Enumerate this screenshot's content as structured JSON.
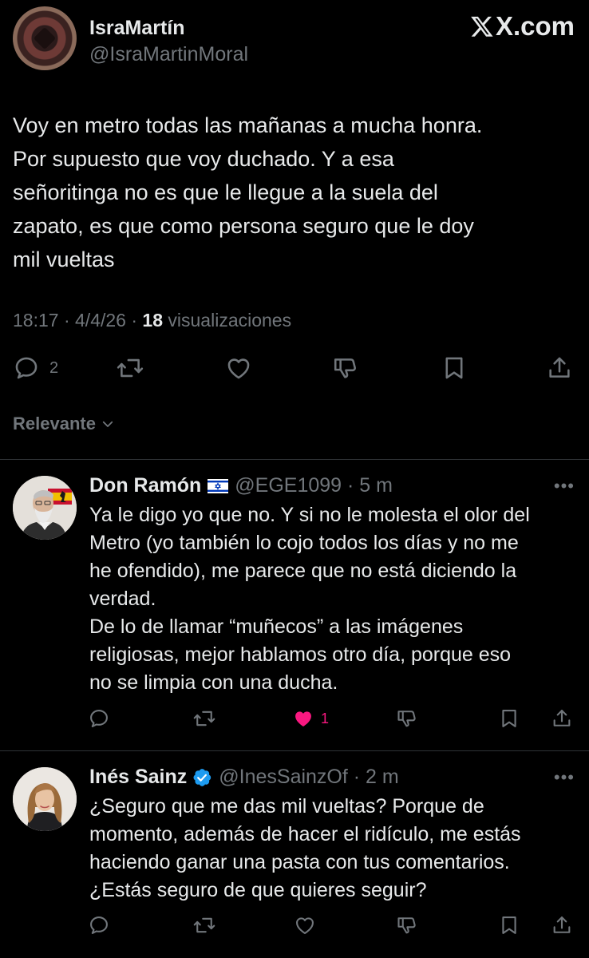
{
  "brand": "X.com",
  "main_tweet": {
    "author_name": "IsraMartín",
    "author_handle": "@IsraMartinMoral",
    "text_lines": [
      "Voy en metro todas las mañanas a mucha honra.",
      "Por supuesto que voy duchado. Y a esa",
      "señoritinga no es que le llegue a la suela del",
      "zapato, es que como persona seguro que le doy",
      "mil vueltas"
    ],
    "time": "18:17",
    "date": "4/4/26",
    "views_count": "18",
    "views_label": "visualizaciones",
    "replies_count": "2"
  },
  "sort": {
    "label": "Relevante"
  },
  "replies": [
    {
      "name": "Don Ramón",
      "handle": "@EGE1099",
      "time": "5 m",
      "text_lines": [
        "Ya le digo yo que no. Y si no le molesta el olor del",
        "Metro (yo también lo cojo todos los días y no me",
        "he ofendido), me parece que no está diciendo la",
        "verdad.",
        "De lo de llamar “muñecos” a las imágenes",
        "religiosas, mejor hablamos otro día, porque eso",
        "no se limpia con una ducha."
      ],
      "likes": "1"
    },
    {
      "name": "Inés Sainz",
      "handle": "@InesSainzOf",
      "time": "2 m",
      "text_lines": [
        "¿Seguro que me das mil vueltas? Porque de",
        "momento, además de hacer el ridículo, me estás",
        "haciendo ganar una pasta con tus comentarios.",
        "¿Estás seguro de que quieres seguir?"
      ]
    }
  ],
  "colors": {
    "background": "#000000",
    "text": "#e7e9ea",
    "muted": "#71767b",
    "divider": "#2f3336",
    "like": "#f91880",
    "verified": "#1d9bf0"
  },
  "icons": [
    "reply-icon",
    "repost-icon",
    "like-icon",
    "dislike-icon",
    "bookmark-icon",
    "share-icon",
    "more-icon",
    "verified-icon",
    "israel-flag-icon",
    "chevron-down-icon"
  ]
}
